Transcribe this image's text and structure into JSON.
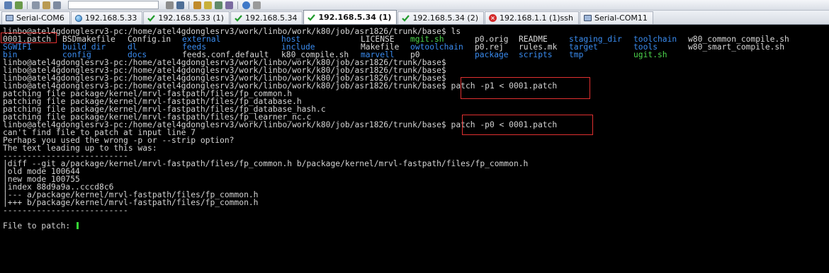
{
  "tabs": [
    {
      "label": "Serial-COM6",
      "icon": "monitor-icon",
      "active": false
    },
    {
      "label": "192.168.5.33",
      "icon": "globe-icon",
      "active": false
    },
    {
      "label": "192.168.5.33 (1)",
      "icon": "check-icon",
      "active": false
    },
    {
      "label": "192.168.5.34",
      "icon": "check-icon",
      "active": false
    },
    {
      "label": "192.168.5.34 (1)",
      "icon": "check-icon",
      "active": true
    },
    {
      "label": "192.168.5.34 (2)",
      "icon": "check-icon",
      "active": false
    },
    {
      "label": "192.168.1.1 (1)ssh",
      "icon": "error-icon",
      "active": false
    },
    {
      "label": "Serial-COM11",
      "icon": "monitor-icon",
      "active": false
    }
  ],
  "terminal": {
    "prompt": "linbo@atel4gdonglesrv3-pc:/home/atel4gdonglesrv3/work/linbo/work/k80/job/asr1826/trunk/base$",
    "cmd_ls": " ls",
    "ls_rows": [
      [
        {
          "text": "0001.patch",
          "color": "white"
        },
        {
          "text": "BSDmakefile",
          "color": "white"
        },
        {
          "text": "Config.in",
          "color": "white"
        },
        {
          "text": "external",
          "color": "blue"
        },
        {
          "text": "host",
          "color": "blue"
        },
        {
          "text": "LICENSE",
          "color": "white"
        },
        {
          "text": "mgit.sh",
          "color": "green"
        },
        {
          "text": "p0.orig",
          "color": "white"
        },
        {
          "text": "README",
          "color": "white"
        },
        {
          "text": "staging_dir",
          "color": "blue"
        },
        {
          "text": "toolchain",
          "color": "blue"
        },
        {
          "text": "w80_common_compile.sh",
          "color": "white"
        }
      ],
      [
        {
          "text": "SGWIFI",
          "color": "blue"
        },
        {
          "text": "build_dir",
          "color": "blue"
        },
        {
          "text": "dl",
          "color": "blue"
        },
        {
          "text": "feeds",
          "color": "blue"
        },
        {
          "text": "include",
          "color": "blue"
        },
        {
          "text": "Makefile",
          "color": "white"
        },
        {
          "text": "owtoolchain",
          "color": "blue"
        },
        {
          "text": "p0.rej",
          "color": "white"
        },
        {
          "text": "rules.mk",
          "color": "white"
        },
        {
          "text": "target",
          "color": "blue"
        },
        {
          "text": "tools",
          "color": "blue"
        },
        {
          "text": "w80_smart_compile.sh",
          "color": "white"
        }
      ],
      [
        {
          "text": "bin",
          "color": "blue"
        },
        {
          "text": "config",
          "color": "blue"
        },
        {
          "text": "docs",
          "color": "blue"
        },
        {
          "text": "feeds.conf.default",
          "color": "white"
        },
        {
          "text": "k80_compile.sh",
          "color": "white"
        },
        {
          "text": "marvell",
          "color": "blue"
        },
        {
          "text": "p0",
          "color": "white"
        },
        {
          "text": "package",
          "color": "blue"
        },
        {
          "text": "scripts",
          "color": "blue"
        },
        {
          "text": "tmp",
          "color": "blue"
        },
        {
          "text": "ugit.sh",
          "color": "green"
        }
      ]
    ],
    "cmd_patch1": " patch -p1 < 0001.patch",
    "patch1_output": [
      "patching file package/kernel/mrvl-fastpath/files/fp_common.h",
      "patching file package/kernel/mrvl-fastpath/files/fp_database.h",
      "patching file package/kernel/mrvl-fastpath/files/fp_database_hash.c",
      "patching file package/kernel/mrvl-fastpath/files/fp_learner_nc.c"
    ],
    "cmd_patch0": " patch -p0 < 0001.patch",
    "patch0_output": [
      "can't find file to patch at input line 7",
      "Perhaps you used the wrong -p or --strip option?",
      "The text leading up to this was:",
      "--------------------------",
      "|diff --git a/package/kernel/mrvl-fastpath/files/fp_common.h b/package/kernel/mrvl-fastpath/files/fp_common.h",
      "|old mode 100644",
      "|new mode 100755",
      "|index 88d9a9a..cccd8c6",
      "|--- a/package/kernel/mrvl-fastpath/files/fp_common.h",
      "|+++ b/package/kernel/mrvl-fastpath/files/fp_common.h",
      "--------------------------",
      "",
      "File to patch: "
    ]
  },
  "colors": {
    "white": "#d8d8d8",
    "blue": "#3a8cf0",
    "green": "#4dd64d",
    "highlight": "#e03030"
  }
}
